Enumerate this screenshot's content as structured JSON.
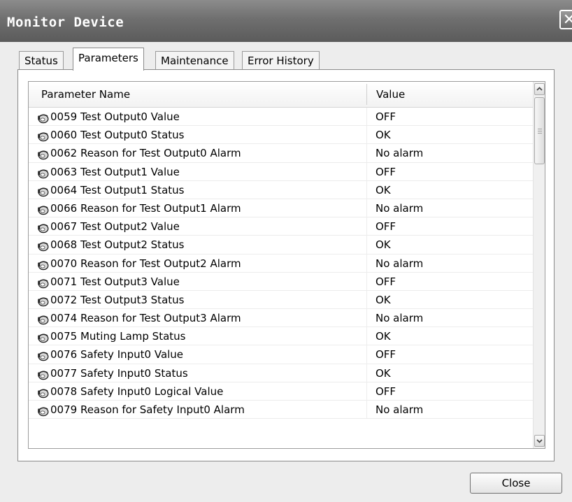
{
  "window": {
    "title": "Monitor Device",
    "close_glyph": "✕"
  },
  "tabs": [
    {
      "label": "Status"
    },
    {
      "label": "Parameters"
    },
    {
      "label": "Maintenance"
    },
    {
      "label": "Error History"
    }
  ],
  "active_tab": "Parameters",
  "grid": {
    "columns": {
      "name": "Parameter Name",
      "value": "Value"
    },
    "row_icon": "parameter-icon",
    "rows": [
      {
        "name": "0059 Test Output0 Value",
        "value": "OFF"
      },
      {
        "name": "0060 Test Output0 Status",
        "value": "OK"
      },
      {
        "name": "0062 Reason for Test Output0 Alarm",
        "value": "No alarm"
      },
      {
        "name": "0063 Test Output1 Value",
        "value": "OFF"
      },
      {
        "name": "0064 Test Output1 Status",
        "value": "OK"
      },
      {
        "name": "0066 Reason for Test Output1 Alarm",
        "value": "No alarm"
      },
      {
        "name": "0067 Test Output2 Value",
        "value": "OFF"
      },
      {
        "name": "0068 Test Output2 Status",
        "value": "OK"
      },
      {
        "name": "0070 Reason for Test Output2 Alarm",
        "value": "No alarm"
      },
      {
        "name": "0071 Test Output3 Value",
        "value": "OFF"
      },
      {
        "name": "0072 Test Output3 Status",
        "value": "OK"
      },
      {
        "name": "0074 Reason for Test Output3 Alarm",
        "value": "No alarm"
      },
      {
        "name": "0075 Muting Lamp Status",
        "value": "OK"
      },
      {
        "name": "0076 Safety Input0 Value",
        "value": "OFF"
      },
      {
        "name": "0077 Safety Input0 Status",
        "value": "OK"
      },
      {
        "name": "0078 Safety Input0 Logical Value",
        "value": "OFF"
      },
      {
        "name": "0079 Reason for Safety Input0 Alarm",
        "value": "No alarm"
      }
    ]
  },
  "footer": {
    "close_label": "Close"
  }
}
